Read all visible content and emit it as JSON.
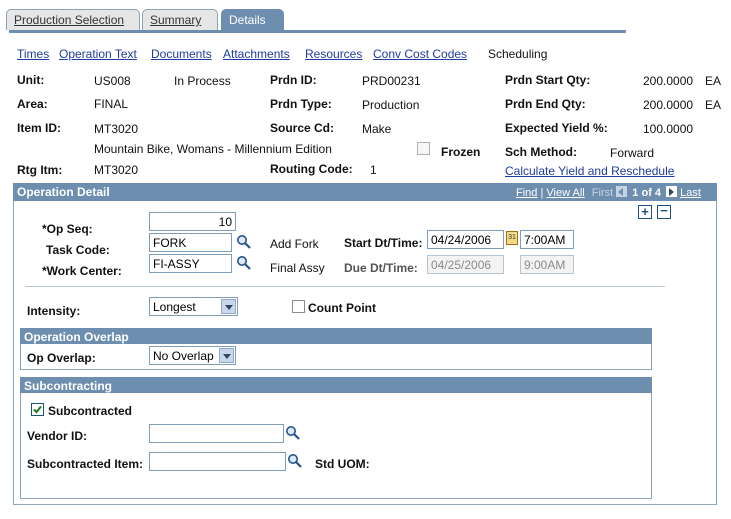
{
  "tabs": [
    {
      "label": "Production Selection",
      "active": false
    },
    {
      "label": "Summary",
      "active": false
    },
    {
      "label": "Details",
      "active": true
    }
  ],
  "sublinks": [
    "Times",
    "Operation Text",
    "Documents",
    "Attachments",
    "Resources",
    "Conv Cost Codes"
  ],
  "sublink_current": "Scheduling",
  "header": {
    "unit_label": "Unit:",
    "unit": "US008",
    "status": "In Process",
    "area_label": "Area:",
    "area": "FINAL",
    "item_label": "Item ID:",
    "item": "MT3020",
    "item_desc": "Mountain Bike, Womans - Millennium Edition",
    "rtg_label": "Rtg Itm:",
    "rtg": "MT3020",
    "prdn_id_label": "Prdn ID:",
    "prdn_id": "PRD00231",
    "prdn_type_label": "Prdn Type:",
    "prdn_type": "Production",
    "source_label": "Source Cd:",
    "source": "Make",
    "frozen_label": "Frozen",
    "routing_label": "Routing Code:",
    "routing": "1",
    "start_qty_label": "Prdn Start Qty:",
    "start_qty": "200.0000",
    "start_uom": "EA",
    "end_qty_label": "Prdn End Qty:",
    "end_qty": "200.0000",
    "end_uom": "EA",
    "yield_label": "Expected Yield %:",
    "yield": "100.0000",
    "sch_label": "Sch Method:",
    "sch": "Forward",
    "calc_link": "Calculate Yield and Reschedule"
  },
  "operation_detail": {
    "title": "Operation Detail",
    "nav_find": "Find",
    "nav_viewall": "View All",
    "nav_first": "First",
    "nav_count": "1 of 4",
    "nav_last": "Last",
    "op_seq_label": "*Op Seq:",
    "op_seq": "10",
    "task_label": "Task Code:",
    "task": "FORK",
    "task_desc": "Add Fork",
    "wc_label": "*Work Center:",
    "wc": "FI-ASSY",
    "wc_desc": "Final Assy",
    "start_label": "Start Dt/Time:",
    "start_date": "04/24/2006",
    "start_time": "7:00AM",
    "due_label": "Due Dt/Time:",
    "due_date": "04/25/2006",
    "due_time": "9:00AM",
    "intensity_label": "Intensity:",
    "intensity": "Longest",
    "count_point_label": "Count Point",
    "overlap_title": "Operation Overlap",
    "overlap_label": "Op Overlap:",
    "overlap": "No Overlap",
    "sub_title": "Subcontracting",
    "subcontracted_label": "Subcontracted",
    "vendor_label": "Vendor ID:",
    "vendor": "",
    "sub_item_label": "Subcontracted Item:",
    "sub_item": "",
    "std_uom_label": "Std UOM:"
  }
}
